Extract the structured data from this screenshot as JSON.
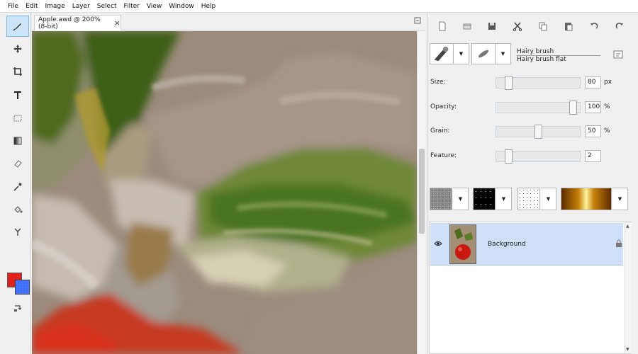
{
  "menubar": {
    "items": [
      "File",
      "Edit",
      "Image",
      "Layer",
      "Select",
      "Filter",
      "View",
      "Window",
      "Help"
    ]
  },
  "document": {
    "tab_title": "Apple.awd @ 200% (8-bit)",
    "close_glyph": "×"
  },
  "toolbox": {
    "tools": [
      "brush-icon",
      "move-icon",
      "crop-icon",
      "text-icon",
      "rectangle-select-icon",
      "gradient-icon",
      "eraser-icon",
      "eyedropper-icon",
      "fill-icon",
      "smudge-icon"
    ],
    "active_tool": "brush-icon",
    "foreground_color": "#e0201c",
    "background_color": "#3f6fff"
  },
  "panel": {
    "toolbar_icons": [
      "new-icon",
      "open-icon",
      "save-icon",
      "cut-icon",
      "copy-icon",
      "paste-icon",
      "undo-icon",
      "redo-icon"
    ],
    "brush": {
      "name": "Hairy brush",
      "variant": "Hairy brush flat"
    },
    "params": [
      {
        "label": "Size:",
        "value": "80",
        "unit": "px",
        "level": 0.11
      },
      {
        "label": "Opacity:",
        "value": "100",
        "unit": "%",
        "level": 0.96
      },
      {
        "label": "Grain:",
        "value": "50",
        "unit": "%",
        "level": 0.5
      },
      {
        "label": "Feature:",
        "value": "2",
        "unit": "",
        "level": 0.11
      }
    ],
    "swatches": [
      "paper-texture",
      "black-speckle",
      "dot-pattern",
      "gold-gradient"
    ]
  },
  "layers": {
    "items": [
      {
        "name": "Background",
        "visible": true,
        "locked": true,
        "selected": true
      }
    ]
  }
}
